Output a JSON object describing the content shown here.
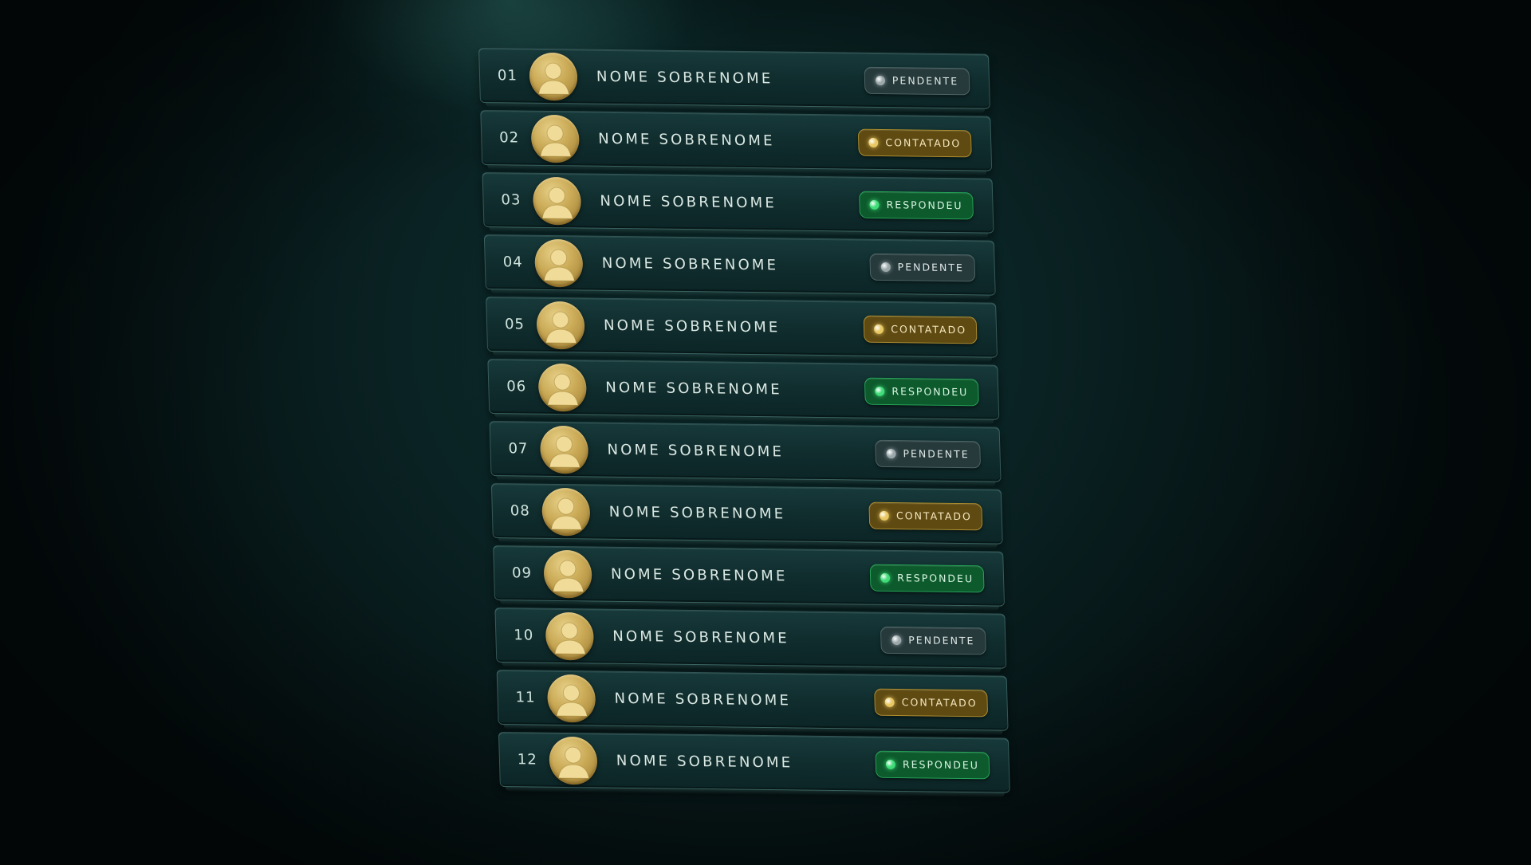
{
  "statuses": {
    "pendente": {
      "label": "PENDENTE",
      "bg": "#26393b",
      "border": "#4d6466",
      "dot": "#9aa8aa",
      "text": "#dfe7e6"
    },
    "contatado": {
      "label": "CONTATADO",
      "bg": "#5f4a12",
      "border": "#b08d2c",
      "dot": "#e8c862",
      "text": "#f3e6bd"
    },
    "respondeu": {
      "label": "RESPONDEU",
      "bg": "#0d5a2c",
      "border": "#23a555",
      "dot": "#3fdc78",
      "text": "#d7f5e2"
    }
  },
  "rows": [
    {
      "num": "01",
      "name": "NOME SOBRENOME",
      "status": "pendente",
      "status_label": "PENDENTE"
    },
    {
      "num": "02",
      "name": "NOME SOBRENOME",
      "status": "contatado",
      "status_label": "CONTATADO"
    },
    {
      "num": "03",
      "name": "NOME SOBRENOME",
      "status": "respondeu",
      "status_label": "RESPONDEU"
    },
    {
      "num": "04",
      "name": "NOME SOBRENOME",
      "status": "pendente",
      "status_label": "PENDENTE"
    },
    {
      "num": "05",
      "name": "NOME SOBRENOME",
      "status": "contatado",
      "status_label": "CONTATADO"
    },
    {
      "num": "06",
      "name": "NOME SOBRENOME",
      "status": "respondeu",
      "status_label": "RESPONDEU"
    },
    {
      "num": "07",
      "name": "NOME SOBRENOME",
      "status": "pendente",
      "status_label": "PENDENTE"
    },
    {
      "num": "08",
      "name": "NOME SOBRENOME",
      "status": "contatado",
      "status_label": "CONTATADO"
    },
    {
      "num": "09",
      "name": "NOME SOBRENOME",
      "status": "respondeu",
      "status_label": "RESPONDEU"
    },
    {
      "num": "10",
      "name": "NOME SOBRENOME",
      "status": "pendente",
      "status_label": "PENDENTE"
    },
    {
      "num": "11",
      "name": "NOME SOBRENOME",
      "status": "contatado",
      "status_label": "CONTATADO"
    },
    {
      "num": "12",
      "name": "NOME SOBRENOME",
      "status": "respondeu",
      "status_label": "RESPONDEU"
    }
  ],
  "icons": {
    "avatar": "user-silhouette-icon",
    "status_dot": "status-dot-icon"
  }
}
